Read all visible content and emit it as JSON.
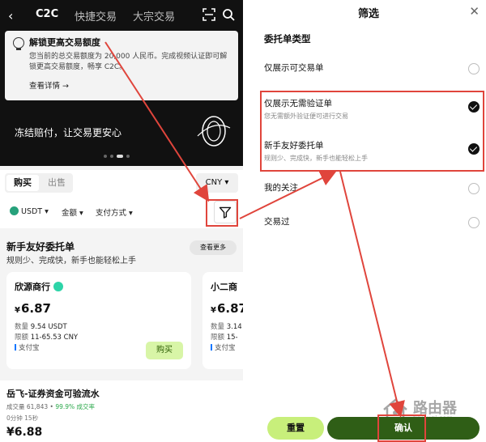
{
  "left": {
    "header_tabs": [
      "C2C",
      "快捷交易",
      "大宗交易"
    ],
    "notice": {
      "title": "解锁更高交易额度",
      "body": "您当前的总交易额度为 20,000 人民币。完成视频认证即可解锁更高交易额度，畅享 C2C。",
      "link": "查看详情 →"
    },
    "banner_text": "冻结赔付，让交易更安心",
    "trade_tabs": {
      "buy": "购买",
      "sell": "出售"
    },
    "currency": "CNY ▾",
    "filters": {
      "coin": "USDT ▾",
      "amount": "金额 ▾",
      "payment": "支付方式 ▾"
    },
    "section": {
      "title": "新手友好委托单",
      "subtitle": "规则少、完成快，新手也能轻松上手",
      "more": "查看更多"
    },
    "cards": [
      {
        "name": "欣源商行",
        "price_sym": "¥",
        "price": "6.87",
        "qty_label": "数量",
        "qty": "9.54 USDT",
        "limit_label": "限额",
        "limit": "11-65.53 CNY",
        "pay": "支付宝",
        "buy": "购买"
      },
      {
        "name": "小二商",
        "price_sym": "¥",
        "price": "6.87",
        "qty_label": "数量",
        "qty": "3.14",
        "limit_label": "限额",
        "limit": "15-",
        "pay": "支付宝"
      }
    ],
    "merchant": {
      "name": "岳飞-证券资金可验流水",
      "deals": "成交量 61,843",
      "rate": "99.9% 成交率",
      "time": "0分钟 15秒",
      "price": "¥6.88"
    }
  },
  "right": {
    "title": "筛选",
    "section": "委托单类型",
    "options": [
      {
        "label": "仅展示可交易单",
        "sub": "",
        "checked": false
      },
      {
        "label": "仅展示无需验证单",
        "sub": "您无需额外验证便可进行交易",
        "checked": true
      },
      {
        "label": "新手友好委托单",
        "sub": "规则少、完成快，新手也能轻松上手",
        "checked": true
      },
      {
        "label": "我的关注",
        "sub": "",
        "checked": false
      },
      {
        "label": "交易过",
        "sub": "",
        "checked": false
      }
    ],
    "reset": "重置",
    "confirm": "确认",
    "watermark": {
      "name": "路由器",
      "url": "luyouqi.com"
    }
  },
  "colors": {
    "accent_green": "#c8ef7b",
    "confirm_green": "#2f5e16",
    "annotation_red": "#e0453c"
  }
}
